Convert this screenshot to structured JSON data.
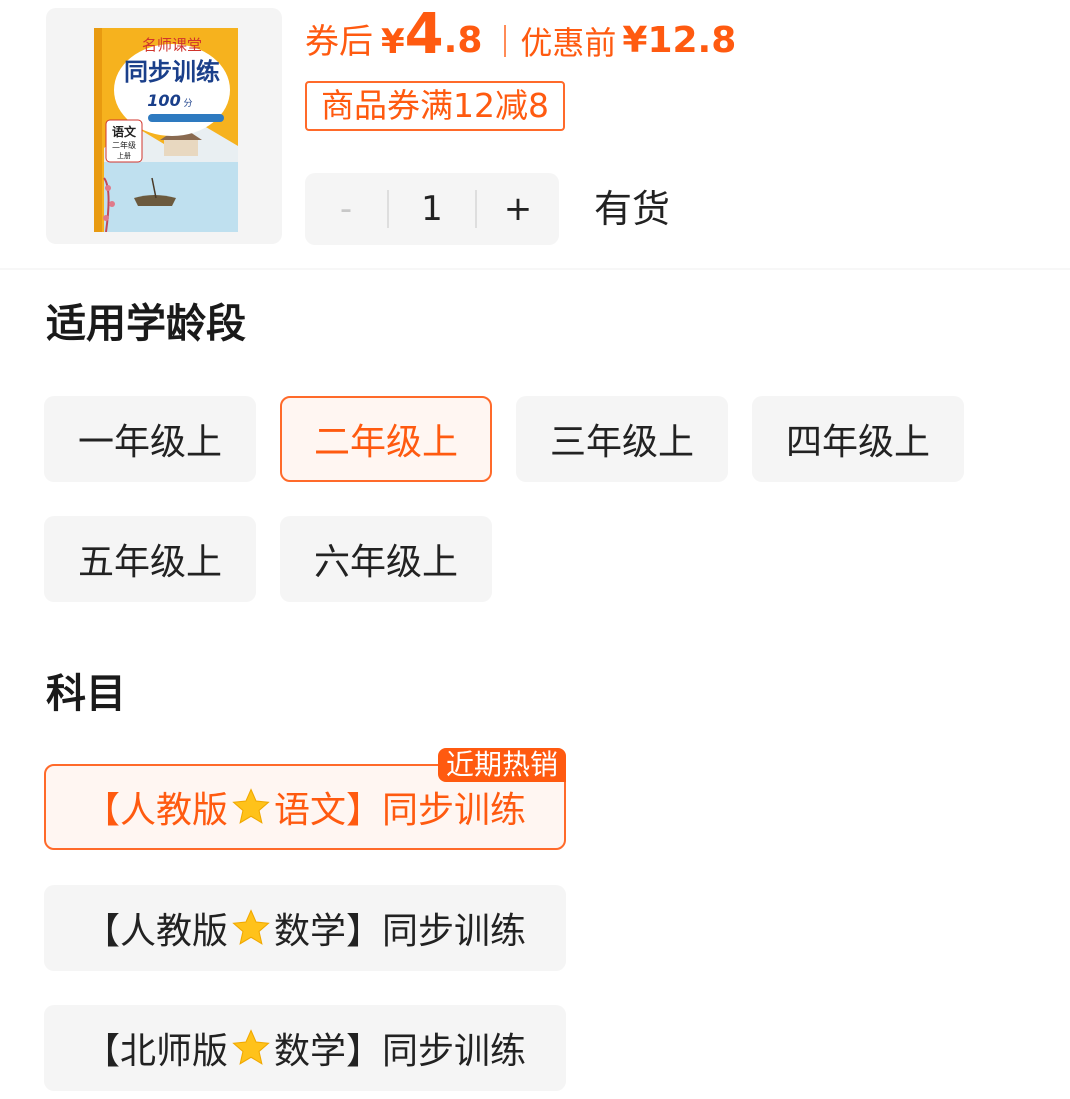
{
  "product": {
    "book_cover": {
      "series": "名师课堂",
      "title": "同步训练",
      "score": "100",
      "score_unit": "分",
      "subject": "语文",
      "grade": "二年级",
      "volume": "上册"
    },
    "price": {
      "after_coupon_label": "券后",
      "currency": "¥",
      "integer": "4",
      "decimal": ".8",
      "before_label": "优惠前",
      "before_value": "¥12.8"
    },
    "coupon": "商品券满12减8",
    "quantity": {
      "minus": "-",
      "value": "1",
      "plus": "+"
    },
    "stock": "有货"
  },
  "sections": {
    "age": {
      "title": "适用学龄段",
      "options": [
        "一年级上",
        "二年级上",
        "三年级上",
        "四年级上",
        "五年级上",
        "六年级上"
      ],
      "selected_index": 1
    },
    "subject": {
      "title": "科目",
      "options": [
        {
          "prefix": "【人教版",
          "suffix": "语文】同步训练",
          "tag": "近期热销"
        },
        {
          "prefix": "【人教版",
          "suffix": "数学】同步训练"
        },
        {
          "prefix": "【北师版",
          "suffix": "数学】同步训练"
        }
      ],
      "selected_index": 0
    }
  },
  "colors": {
    "accent": "#ff5a10",
    "option_bg": "#f5f5f5",
    "selected_bg": "#fff6f2"
  },
  "icons": [
    "star-icon"
  ]
}
